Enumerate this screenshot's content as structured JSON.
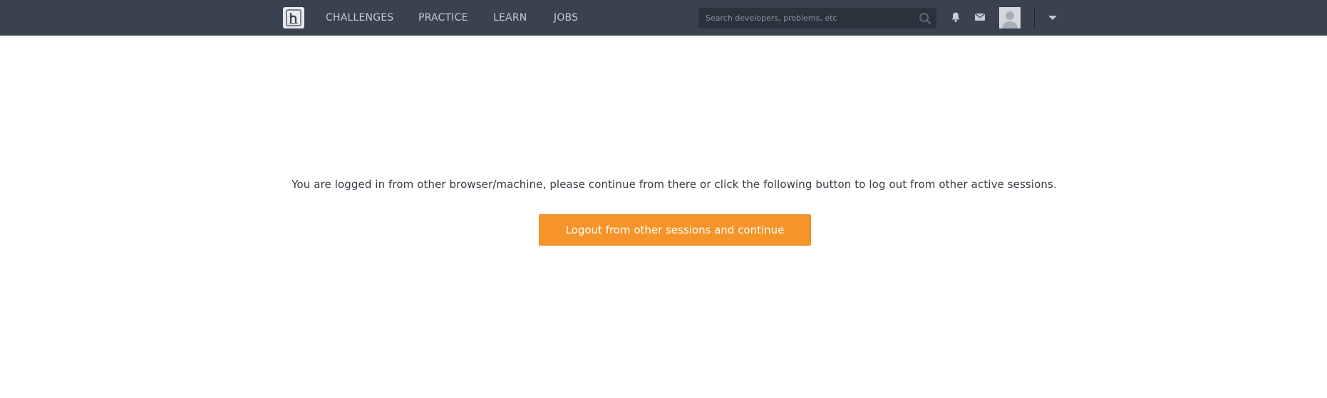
{
  "header": {
    "logo_letter": "h",
    "nav": [
      {
        "label": "CHALLENGES"
      },
      {
        "label": "PRACTICE"
      },
      {
        "label": "LEARN"
      },
      {
        "label": "JOBS"
      }
    ],
    "search": {
      "placeholder": "Search developers, problems, etc",
      "value": ""
    },
    "icons": {
      "search": "search-icon",
      "notifications": "bell-icon",
      "messages": "mail-icon",
      "avatar": "user-avatar",
      "menu": "chevron-down-icon"
    }
  },
  "main": {
    "message": "You are logged in from other browser/machine, please continue from there or click the following button to log out from other active sessions.",
    "button_label": "Logout from other sessions and continue"
  },
  "colors": {
    "topbar": "#39424e",
    "accent": "#f59428",
    "text": "#333b45",
    "nav_text": "#c6cbd3"
  }
}
